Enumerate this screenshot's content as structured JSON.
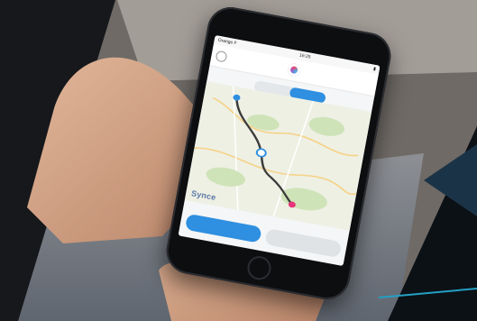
{
  "statusbar": {
    "carrier": "Orange F",
    "time": "16:25",
    "battery": ""
  },
  "toggle": {
    "left": "",
    "right": ""
  },
  "brand": "Synce",
  "buttons": {
    "primary": "",
    "secondary": ""
  },
  "colors": {
    "accent": "#2f8fe0",
    "route": "#3b3b3b",
    "start_pin": "#2f8fe0",
    "end_pin": "#e8347a"
  }
}
